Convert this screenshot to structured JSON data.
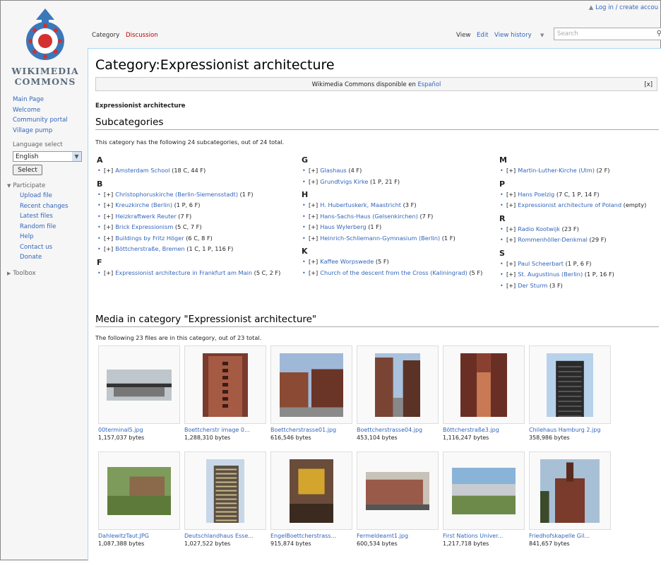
{
  "personal": {
    "login": "Log in / create accou"
  },
  "logo": {
    "line1": "WIKIMEDIA",
    "line2": "COMMONS"
  },
  "sidebar": {
    "nav": [
      "Main Page",
      "Welcome",
      "Community portal",
      "Village pump"
    ],
    "language_heading": "Language select",
    "language_value": "English",
    "select_button": "Select",
    "participate_heading": "Participate",
    "participate": [
      "Upload file",
      "Recent changes",
      "Latest files",
      "Random file",
      "Help",
      "Contact us",
      "Donate"
    ],
    "toolbox_heading": "Toolbox"
  },
  "tabs": {
    "category": "Category",
    "discussion": "Discussion",
    "view": "View",
    "edit": "Edit",
    "history": "View history",
    "search_placeholder": "Search"
  },
  "page": {
    "title": "Category:Expressionist architecture",
    "notice_text": "Wikimedia Commons disponible en ",
    "notice_link": "Español",
    "notice_close": "[x]",
    "category_desc": "Expressionist architecture",
    "subcats_heading": "Subcategories",
    "subcats_count": "This category has the following 24 subcategories, out of 24 total.",
    "media_heading": "Media in category \"Expressionist architecture\"",
    "media_count": "The following 23 files are in this category, out of 23 total."
  },
  "subcategories": {
    "col1": [
      {
        "letter": "A",
        "items": [
          {
            "name": "Amsterdam School",
            "count": "(18 C, 44 F)"
          }
        ]
      },
      {
        "letter": "B",
        "items": [
          {
            "name": "Christophoruskirche (Berlin-Siemensstadt)",
            "count": "(1 F)"
          },
          {
            "name": "Kreuzkirche (Berlin)",
            "count": "(1 P, 6 F)"
          },
          {
            "name": "Heizkraftwerk Reuter",
            "count": "(7 F)"
          },
          {
            "name": "Brick Expressionism",
            "count": "(5 C, 7 F)"
          },
          {
            "name": "Buildings by Fritz Höger",
            "count": "(6 C, 8 F)"
          },
          {
            "name": "Böttcherstraße, Bremen",
            "count": "(1 C, 1 P, 116 F)"
          }
        ]
      },
      {
        "letter": "F",
        "items": [
          {
            "name": "Expressionist architecture in Frankfurt am Main",
            "count": "(5 C, 2 F)"
          }
        ]
      }
    ],
    "col2": [
      {
        "letter": "G",
        "items": [
          {
            "name": "Glashaus",
            "count": "(4 F)"
          },
          {
            "name": "Grundtvigs Kirke",
            "count": "(1 P, 21 F)"
          }
        ]
      },
      {
        "letter": "H",
        "items": [
          {
            "name": "H. Hubertuskerk, Maastricht",
            "count": "(3 F)"
          },
          {
            "name": "Hans-Sachs-Haus (Gelsenkirchen)",
            "count": "(7 F)"
          },
          {
            "name": "Haus Wylerberg",
            "count": "(1 F)"
          },
          {
            "name": "Heinrich-Schliemann-Gymnasium (Berlin)",
            "count": "(1 F)"
          }
        ]
      },
      {
        "letter": "K",
        "items": [
          {
            "name": "Kaffee Worpswede",
            "count": "(5 F)"
          },
          {
            "name": "Church of the descent from the Cross (Kaliningrad)",
            "count": "(5 F)"
          }
        ]
      }
    ],
    "col3": [
      {
        "letter": "M",
        "items": [
          {
            "name": "Martin-Luther-Kirche (Ulm)",
            "count": "(2 F)"
          }
        ]
      },
      {
        "letter": "P",
        "items": [
          {
            "name": "Hans Poelzig",
            "count": "(7 C, 1 P, 14 F)"
          },
          {
            "name": "Expressionist architecture of Poland",
            "count": "(empty)"
          }
        ]
      },
      {
        "letter": "R",
        "items": [
          {
            "name": "Radio Kootwijk",
            "count": "(23 F)"
          },
          {
            "name": "Rommenhöller-Denkmal",
            "count": "(29 F)"
          }
        ]
      },
      {
        "letter": "S",
        "items": [
          {
            "name": "Paul Scheerbart",
            "count": "(1 P, 6 F)"
          },
          {
            "name": "St. Augustinus (Berlin)",
            "count": "(1 P, 16 F)"
          },
          {
            "name": "Der Sturm",
            "count": "(3 F)"
          }
        ]
      }
    ],
    "expand": "[+]"
  },
  "media": [
    {
      "name": "00terminal5.jpg",
      "size": "1,157,037 bytes"
    },
    {
      "name": "Boettcherstr image 0...",
      "size": "1,288,310 bytes"
    },
    {
      "name": "Boettcherstrasse01.jpg",
      "size": "616,546 bytes"
    },
    {
      "name": "Boettcherstrasse04.jpg",
      "size": "453,104 bytes"
    },
    {
      "name": "Böttcherstraße3.jpg",
      "size": "1,116,247 bytes"
    },
    {
      "name": "Chilehaus Hamburg 2.jpg",
      "size": "358,986 bytes"
    },
    {
      "name": "DahlewitzTaut.JPG",
      "size": "1,087,388 bytes"
    },
    {
      "name": "Deutschlandhaus Esse...",
      "size": "1,027,522 bytes"
    },
    {
      "name": "EngelBoettcherstrass...",
      "size": "915,874 bytes"
    },
    {
      "name": "Fermeldeamt1.jpg",
      "size": "600,534 bytes"
    },
    {
      "name": "First Nations Univer...",
      "size": "1,217,718 bytes"
    },
    {
      "name": "Friedhofskapelle Gil...",
      "size": "841,657 bytes"
    }
  ]
}
